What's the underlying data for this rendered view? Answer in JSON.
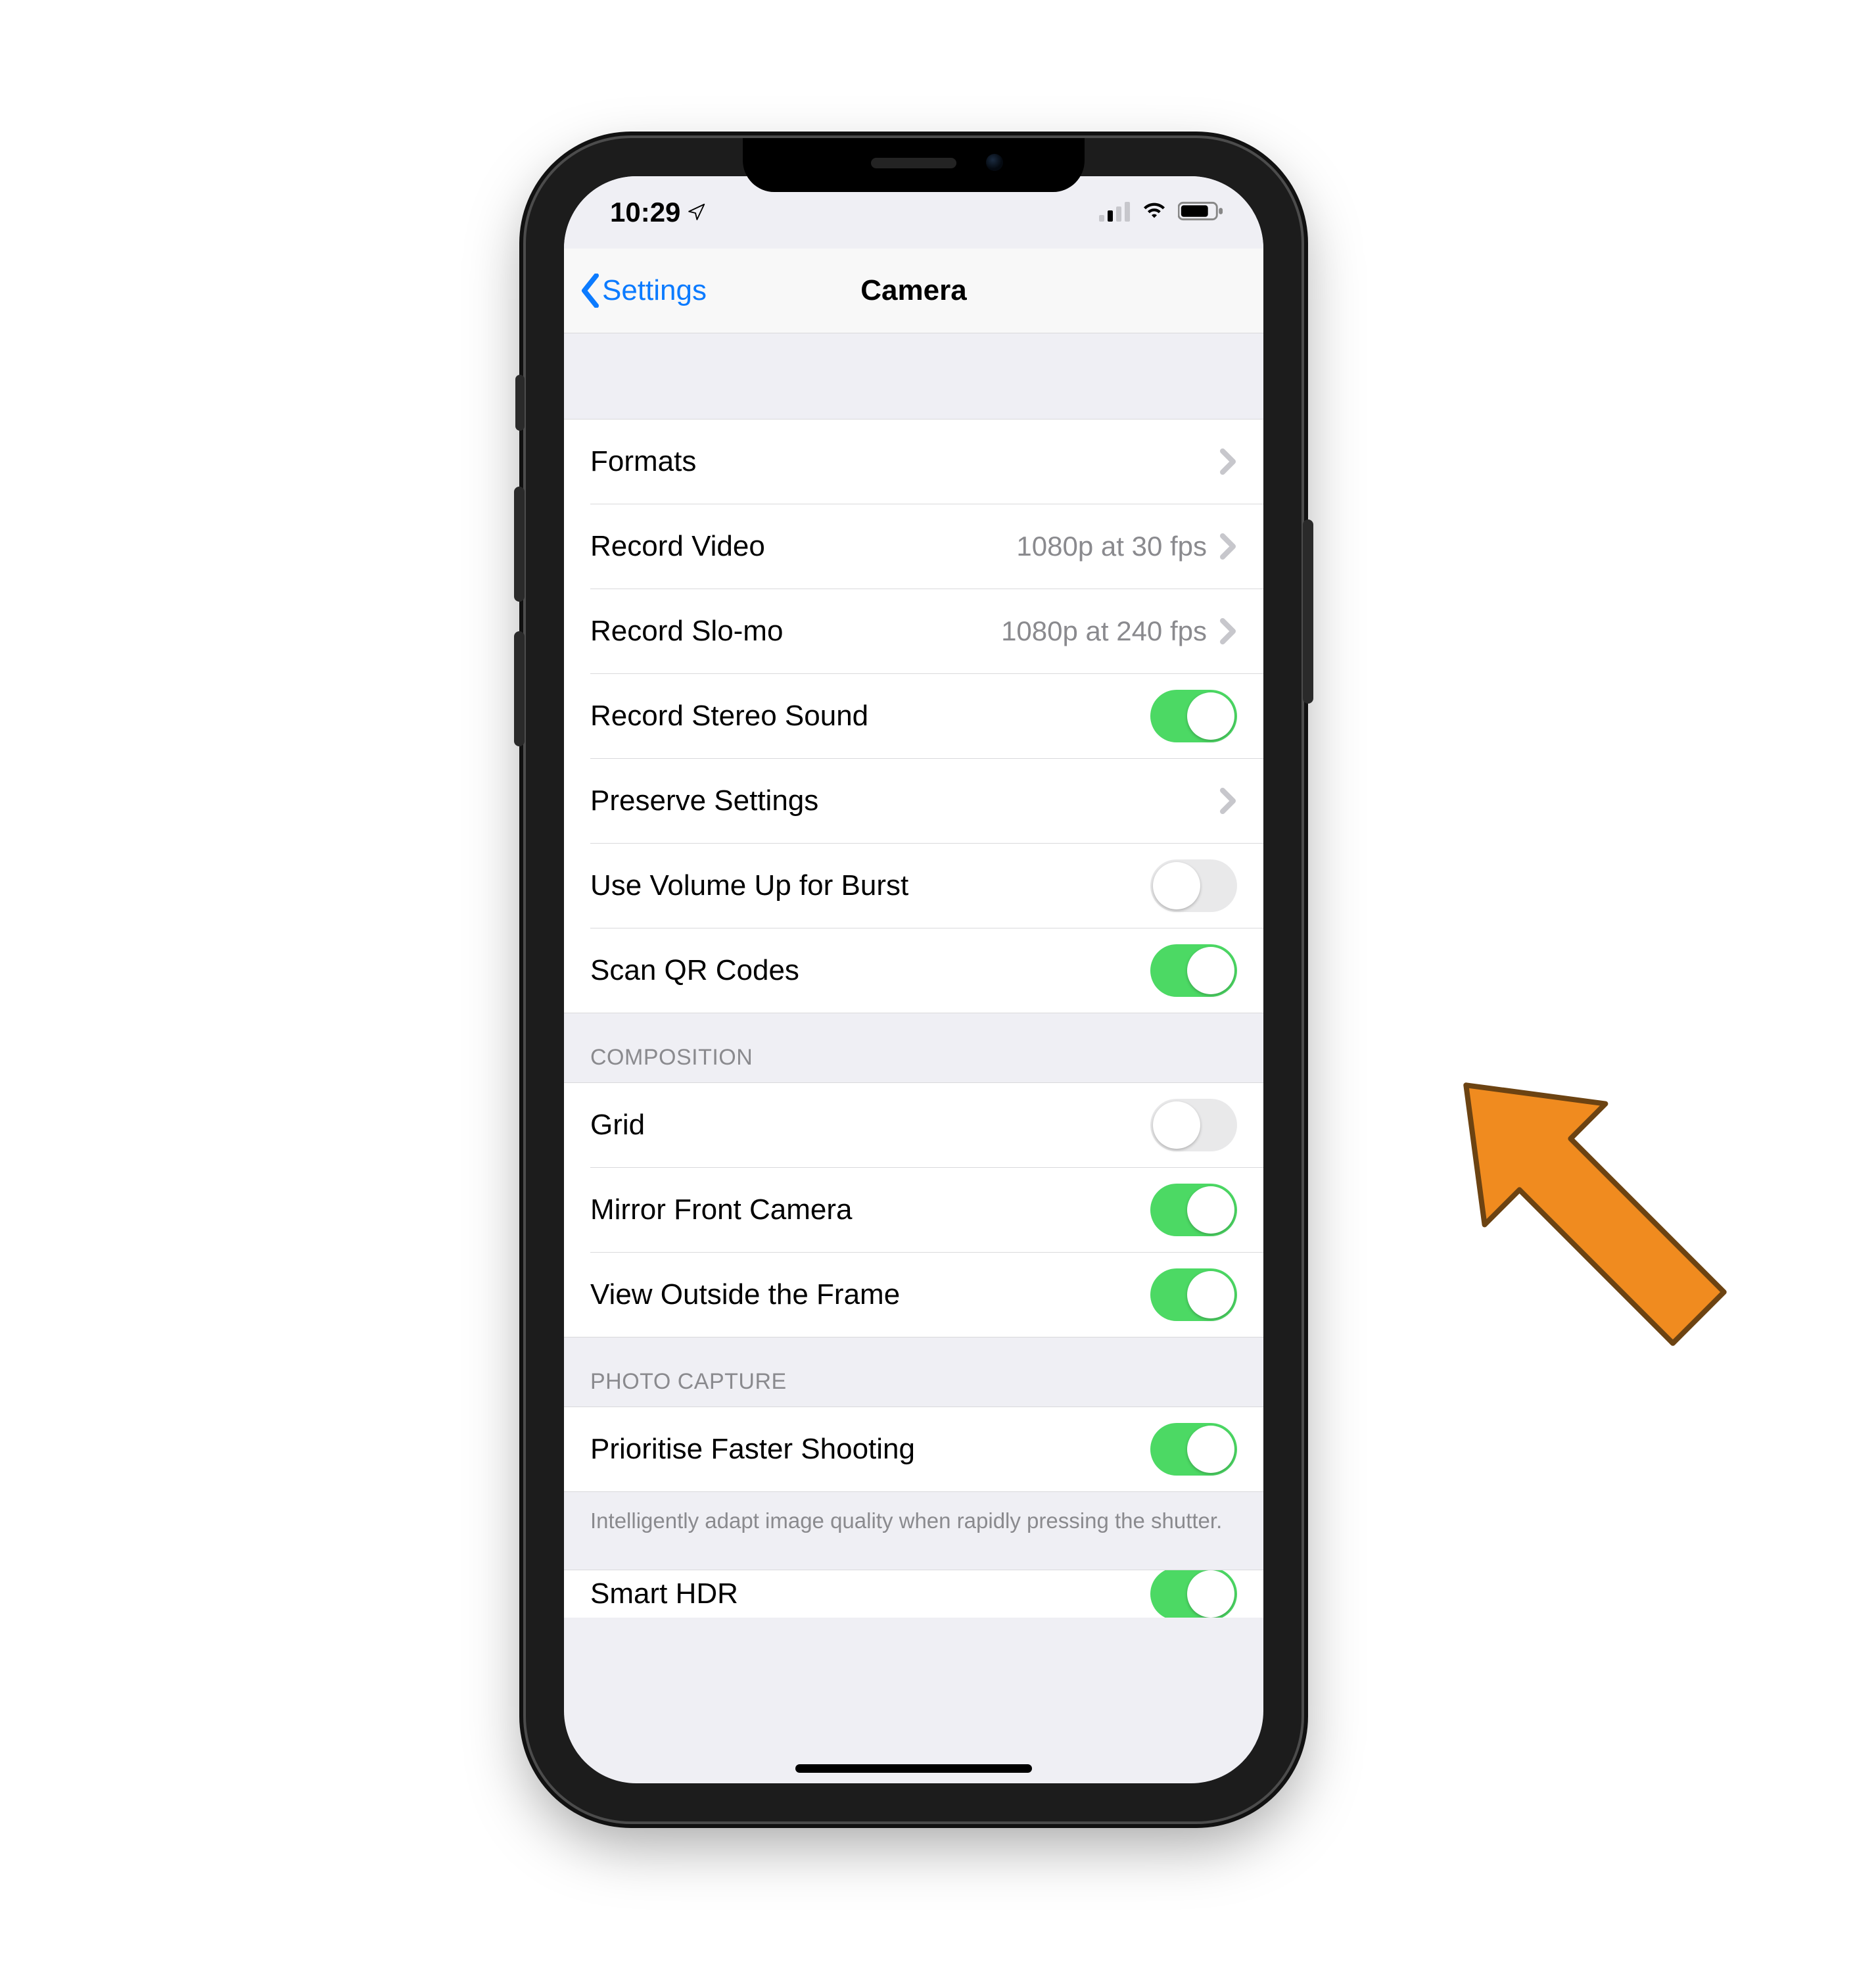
{
  "status": {
    "time": "10:29"
  },
  "nav": {
    "back_label": "Settings",
    "title": "Camera"
  },
  "group1": {
    "formats": "Formats",
    "record_video": "Record Video",
    "record_video_detail": "1080p at 30 fps",
    "record_slomo": "Record Slo-mo",
    "record_slomo_detail": "1080p at 240 fps",
    "record_stereo": "Record Stereo Sound",
    "preserve": "Preserve Settings",
    "volume_burst": "Use Volume Up for Burst",
    "scan_qr": "Scan QR Codes"
  },
  "composition": {
    "header": "COMPOSITION",
    "grid": "Grid",
    "mirror": "Mirror Front Camera",
    "view_outside": "View Outside the Frame"
  },
  "capture": {
    "header": "PHOTO CAPTURE",
    "prioritise": "Prioritise Faster Shooting",
    "footer": "Intelligently adapt image quality when rapidly pressing the shutter.",
    "smart_hdr": "Smart HDR"
  },
  "toggles": {
    "record_stereo": true,
    "volume_burst": false,
    "scan_qr": true,
    "grid": false,
    "mirror": true,
    "view_outside": true,
    "prioritise": true,
    "smart_hdr": true
  }
}
